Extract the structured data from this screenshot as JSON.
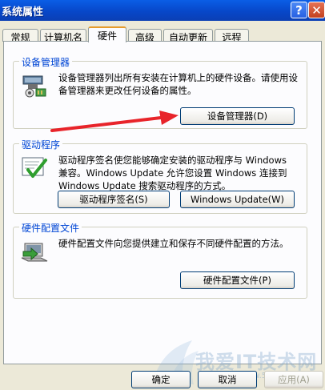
{
  "window": {
    "title": "系统属性",
    "help_glyph": "?",
    "close_glyph": "✕"
  },
  "tabs": [
    {
      "label": "常规"
    },
    {
      "label": "计算机名"
    },
    {
      "label": "硬件"
    },
    {
      "label": "高级"
    },
    {
      "label": "自动更新"
    },
    {
      "label": "远程"
    }
  ],
  "device_manager": {
    "title": "设备管理器",
    "description": "设备管理器列出所有安装在计算机上的硬件设备。请使用设备管理器来更改任何设备的属性。",
    "button": "设备管理器(D)",
    "icon": "device-manager-icon"
  },
  "drivers": {
    "title": "驱动程序",
    "description": "驱动程序签名使您能够确定安装的驱动程序与 Windows 兼容。Windows Update 允许您设置 Windows 连接到 Windows Update 搜索驱动程序的方式。",
    "signing_button": "驱动程序签名(S)",
    "update_button": "Windows Update(W)",
    "icon": "driver-signing-icon"
  },
  "hardware_profiles": {
    "title": "硬件配置文件",
    "description": "硬件配置文件向您提供建立和保存不同硬件配置的方法。",
    "button": "硬件配置文件(P)",
    "icon": "hardware-profile-icon"
  },
  "footer": {
    "ok": "确定",
    "cancel": "取消",
    "apply": "应用(A)"
  },
  "watermark": {
    "text": "我爱IT技术网",
    "url": "www.52it.com"
  },
  "colors": {
    "titlebar": "#0747c9",
    "group_title": "#0046d5",
    "annotation_arrow": "#e8242a"
  }
}
